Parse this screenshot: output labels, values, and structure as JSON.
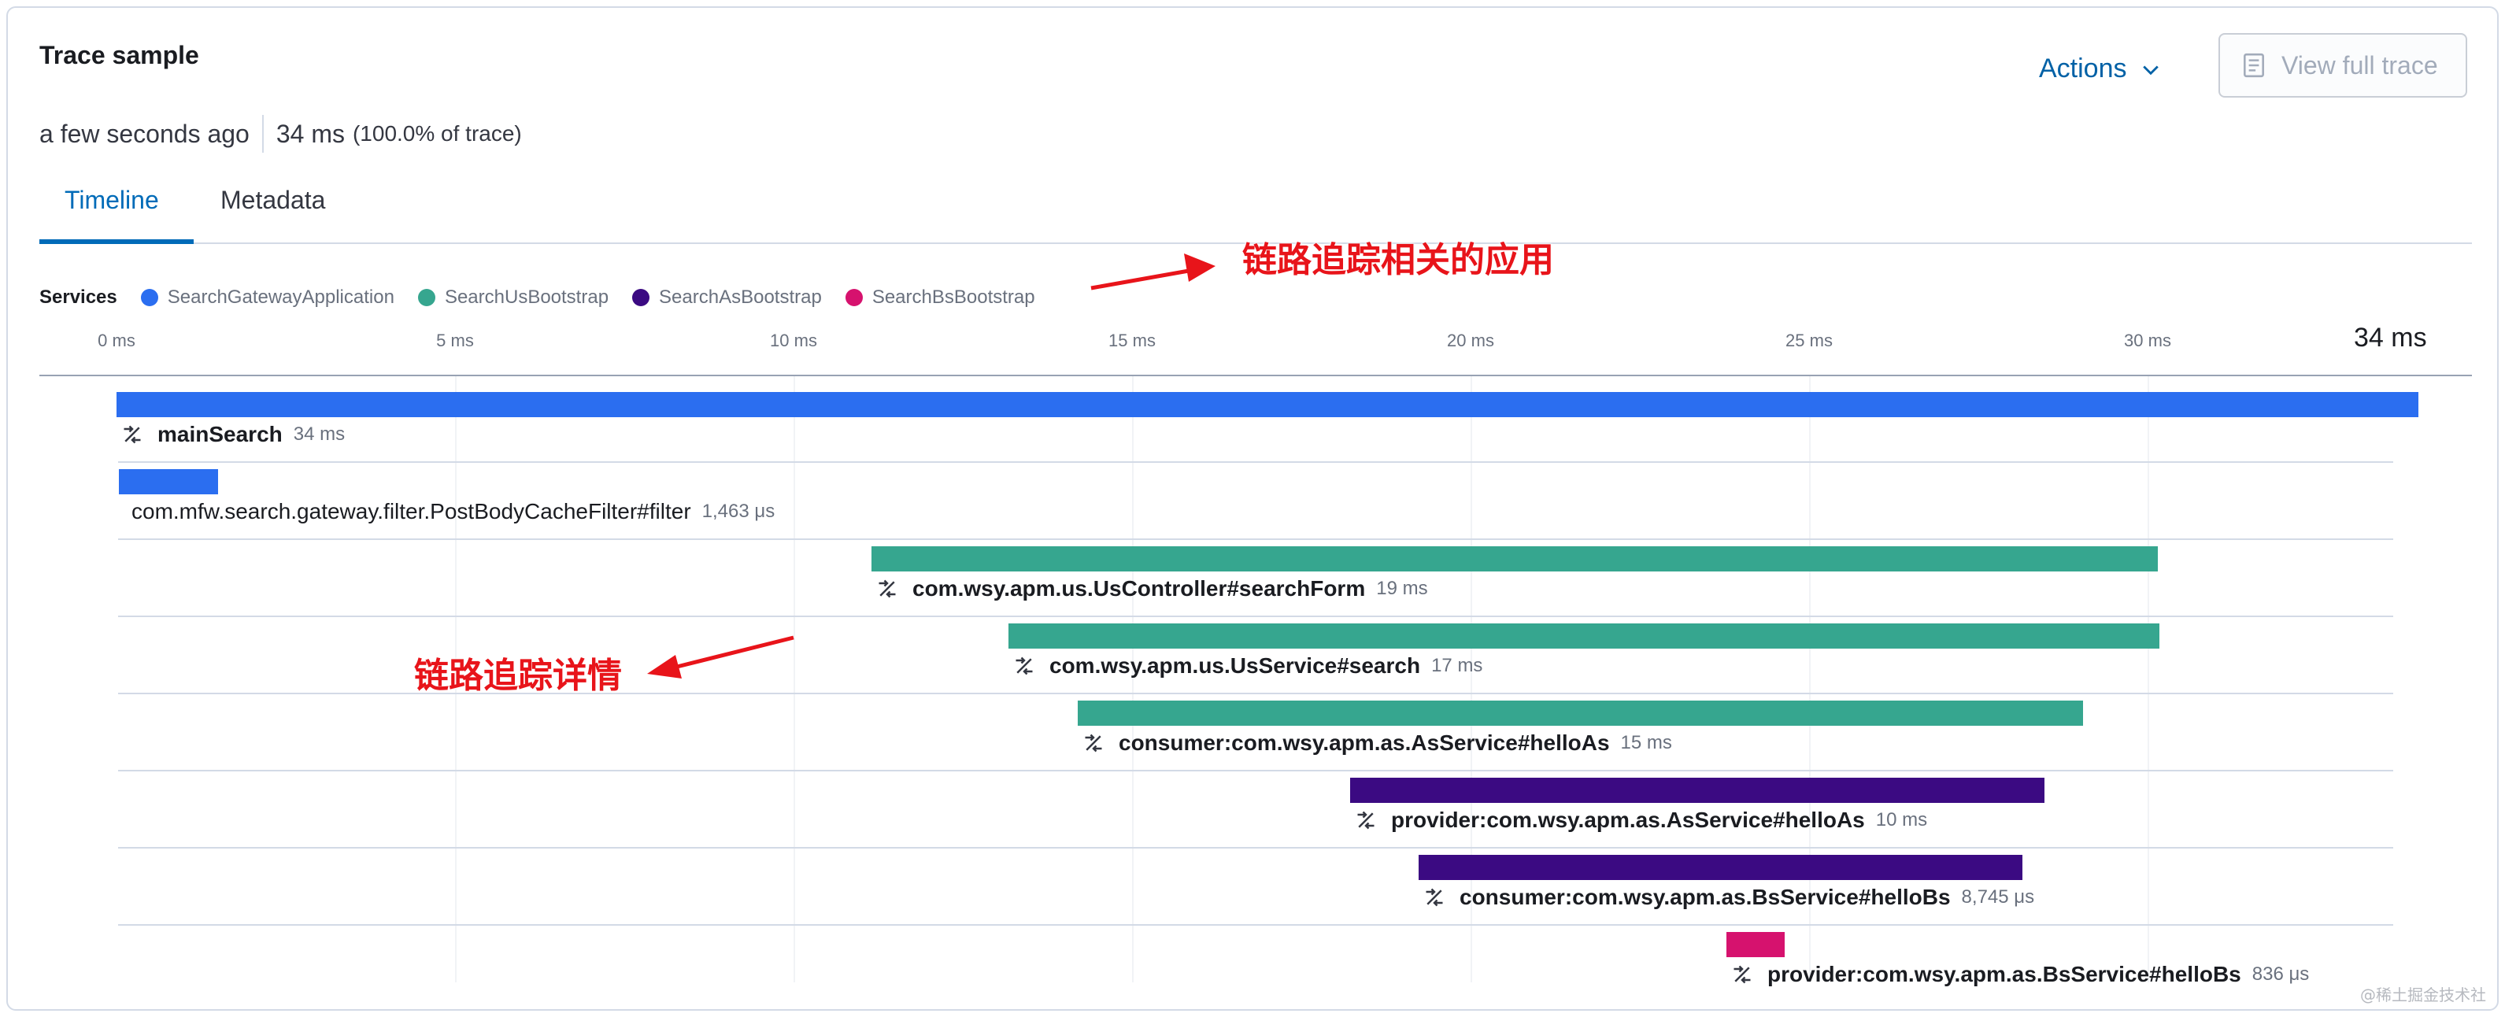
{
  "header": {
    "title": "Trace sample",
    "age": "a few seconds ago",
    "duration": "34 ms",
    "percent": "(100.0% of trace)",
    "actions_label": "Actions",
    "view_full_trace_label": "View full trace"
  },
  "tabs": [
    {
      "label": "Timeline",
      "active": true
    },
    {
      "label": "Metadata",
      "active": false
    }
  ],
  "services": {
    "label": "Services",
    "items": [
      {
        "name": "SearchGatewayApplication",
        "color": "#2b6ef0"
      },
      {
        "name": "SearchUsBootstrap",
        "color": "#36a68f"
      },
      {
        "name": "SearchAsBootstrap",
        "color": "#3b0a82"
      },
      {
        "name": "SearchBsBootstrap",
        "color": "#d6126e"
      }
    ]
  },
  "annotations": {
    "services_note": "链路追踪相关的应用",
    "details_note": "链路追踪详情"
  },
  "timeline": {
    "ticks": [
      "0 ms",
      "5 ms",
      "10 ms",
      "15 ms",
      "20 ms",
      "25 ms",
      "30 ms"
    ],
    "end_label": "34 ms",
    "total_ms": 34,
    "spans": [
      {
        "name": "mainSearch",
        "duration": "34 ms",
        "start_ms": 0,
        "dur_ms": 34,
        "service": 0,
        "icon": true,
        "bold": true
      },
      {
        "name": "com.mfw.search.gateway.filter.PostBodyCacheFilter#filter",
        "duration": "1,463 μs",
        "start_ms": 0.04,
        "dur_ms": 1.463,
        "service": 0,
        "icon": false,
        "bold": false
      },
      {
        "name": "com.wsy.apm.us.UsController#searchForm",
        "duration": "19 ms",
        "start_ms": 11.15,
        "dur_ms": 19.0,
        "service": 1,
        "icon": true,
        "bold": true
      },
      {
        "name": "com.wsy.apm.us.UsService#search",
        "duration": "17 ms",
        "start_ms": 13.18,
        "dur_ms": 17.0,
        "service": 1,
        "icon": true,
        "bold": true
      },
      {
        "name": "consumer:com.wsy.apm.as.AsService#helloAs",
        "duration": "15 ms",
        "start_ms": 14.2,
        "dur_ms": 14.85,
        "service": 1,
        "icon": true,
        "bold": true
      },
      {
        "name": "provider:com.wsy.apm.as.AsService#helloAs",
        "duration": "10 ms",
        "start_ms": 18.22,
        "dur_ms": 10.26,
        "service": 2,
        "icon": true,
        "bold": true
      },
      {
        "name": "consumer:com.wsy.apm.as.BsService#helloBs",
        "duration": "8,745 μs",
        "start_ms": 19.23,
        "dur_ms": 8.92,
        "service": 2,
        "icon": true,
        "bold": true
      },
      {
        "name": "provider:com.wsy.apm.as.BsService#helloBs",
        "duration": "836 μs",
        "start_ms": 23.78,
        "dur_ms": 0.86,
        "service": 3,
        "icon": true,
        "bold": true
      }
    ]
  },
  "watermark": "@稀土掘金技术社区"
}
